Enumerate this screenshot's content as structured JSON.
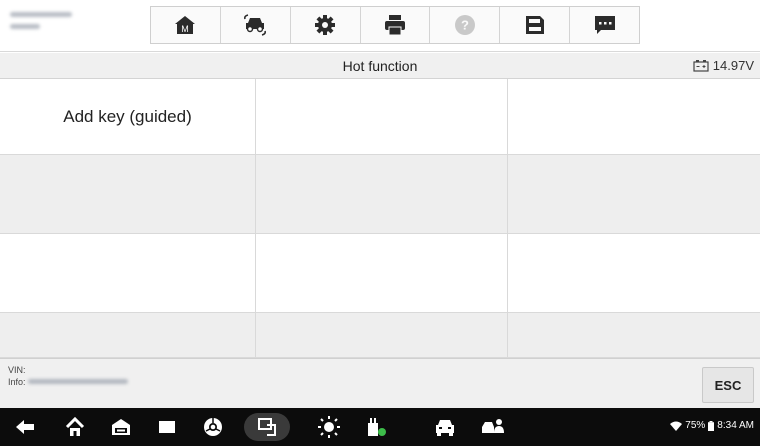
{
  "header": {
    "toolbar": [
      {
        "icon": "home-icon"
      },
      {
        "icon": "vehicle-swap-icon"
      },
      {
        "icon": "gear-icon"
      },
      {
        "icon": "printer-icon"
      },
      {
        "icon": "help-icon"
      },
      {
        "icon": "save-icon"
      },
      {
        "icon": "message-icon"
      }
    ],
    "home_badge": "M"
  },
  "titlebar": {
    "title": "Hot function",
    "battery_voltage": "14.97V"
  },
  "functions": [
    {
      "label": "Add key (guided)"
    },
    {
      "label": ""
    },
    {
      "label": ""
    },
    {
      "label": ""
    },
    {
      "label": ""
    },
    {
      "label": ""
    },
    {
      "label": ""
    },
    {
      "label": ""
    },
    {
      "label": ""
    },
    {
      "label": ""
    },
    {
      "label": ""
    },
    {
      "label": ""
    }
  ],
  "footer": {
    "vin_label": "VIN:",
    "info_label": "Info:",
    "esc_label": "ESC"
  },
  "navbar": {
    "battery_percent": "75%",
    "time": "8:34 AM"
  },
  "colors": {
    "background": "#ffffff",
    "row_alt": "#eeeeee",
    "navbar": "#0c0c0c",
    "icon_dark": "#2b2b2b"
  }
}
